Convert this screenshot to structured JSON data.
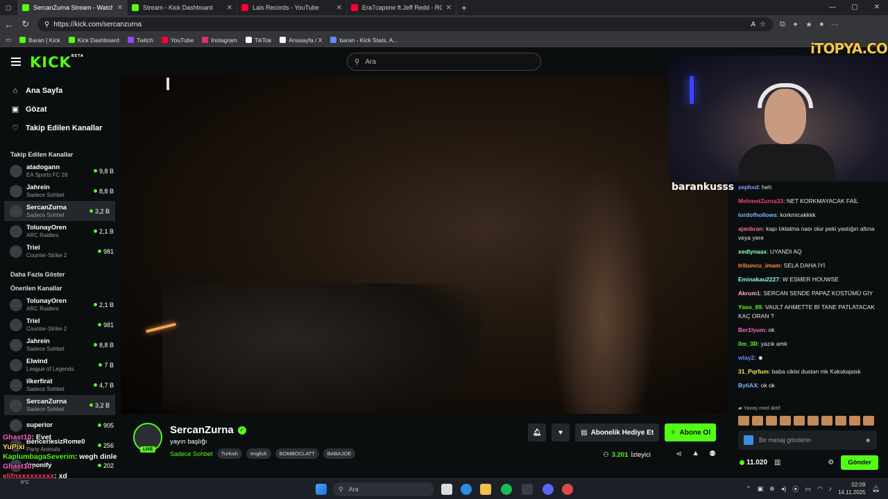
{
  "browser": {
    "tabs": [
      {
        "title": "SercanZurna Stream - Watch",
        "color": "#53fc18",
        "active": true
      },
      {
        "title": "Stream - Kick Dashboard",
        "color": "#53fc18",
        "active": false
      },
      {
        "title": "Lais Records - YouTube",
        "color": "#ff0033",
        "active": false
      },
      {
        "title": "Era7capone ft.Jeff Redd - ROMAN",
        "color": "#ff0033",
        "active": false
      }
    ],
    "url": "https://kick.com/sercanzurna",
    "bookmarks": [
      "Baran | Kick",
      "Kick Dashboard",
      "Twitch",
      "YouTube",
      "Instagram",
      "TikTok",
      "Anasayfa / X",
      "baran - Kick Stats, A..."
    ]
  },
  "kick": {
    "logo": "KICK",
    "logo_badge": "BETA",
    "search_placeholder": "Ara",
    "nav": {
      "home": "Ana Sayfa",
      "browse": "Gözat",
      "following": "Takip Edilen Kanallar"
    },
    "followed_title": "Takip Edilen Kanallar",
    "followed": [
      {
        "name": "atadogann",
        "cat": "EA Sports FC 26",
        "viewers": "9,8 B"
      },
      {
        "name": "Jahrein",
        "cat": "Sadece Sohbet",
        "viewers": "8,8 B"
      },
      {
        "name": "SercanZurna",
        "cat": "Sadece Sohbet",
        "viewers": "3,2 B"
      },
      {
        "name": "TolunayOren",
        "cat": "ARC Raiders",
        "viewers": "2,1 B"
      },
      {
        "name": "Triel",
        "cat": "Counter-Strike 2",
        "viewers": "981"
      }
    ],
    "show_more": "Daha Fazla Göster",
    "recommended_title": "Önerilen Kanallar",
    "recommended": [
      {
        "name": "TolunayOren",
        "cat": "ARC Raiders",
        "viewers": "2,1 B"
      },
      {
        "name": "Triel",
        "cat": "Counter-Strike 2",
        "viewers": "981"
      },
      {
        "name": "Jahrein",
        "cat": "Sadece Sohbet",
        "viewers": "8,8 B"
      },
      {
        "name": "Elwind",
        "cat": "League of Legends",
        "viewers": "7 B"
      },
      {
        "name": "ilkerfirat",
        "cat": "Sadece Sohbet",
        "viewers": "4,7 B"
      },
      {
        "name": "SercanZurna",
        "cat": "Sadece Sohbet",
        "viewers": "3,2 B"
      },
      {
        "name": "superior",
        "cat": "",
        "viewers": "905"
      },
      {
        "name": "BenceriksizRome0",
        "cat": "Party Animals",
        "viewers": "256"
      },
      {
        "name": "limonify",
        "cat": "",
        "viewers": "202"
      }
    ],
    "stream": {
      "title": "SercanZurna",
      "subtitle": "yayın başlığı",
      "category": "Sadece Sohbet",
      "tags": [
        "Turkish",
        "english",
        "BOMBOCLATT",
        "BABAJOE"
      ],
      "live": "LIVE",
      "gift_sub": "Abonelik Hediye Et",
      "subscribe": "Abone Ol",
      "viewers": "3.201",
      "viewers_label": "İzleyici"
    },
    "watermark": "iTOPYA.COM",
    "cam_name": "barankusss",
    "chat": [
      {
        "user": "zephxd",
        "color": "#7fa3ff",
        "text": "heh"
      },
      {
        "user": "MehmetZurna33",
        "color": "#ff3c6a",
        "text": "NET KORKMAYACAK FAİL"
      },
      {
        "user": "lordofhollows",
        "color": "#7fb8ff",
        "text": "korkmicakkkk"
      },
      {
        "user": "ajanbran",
        "color": "#ff6a8a",
        "text": "kapı tıklatma nası olur peki yastığın altına veya yere"
      },
      {
        "user": "xedlynaax",
        "color": "#8affb8",
        "text": "UYANDI AQ"
      },
      {
        "user": "tribuncu_imam",
        "color": "#ff8c3a",
        "text": "SELA DAHA İYİ"
      },
      {
        "user": "Eminakau2227",
        "color": "#8affe0",
        "text": "W ESMER HOUWSE"
      },
      {
        "user": "Akrum1",
        "color": "#ffb0d0",
        "text": "SERCAN SENDE PAPAZ KOSTÜMÜ GİY"
      },
      {
        "user": "Yaso_69",
        "color": "#53fc18",
        "text": "VAULT AHMETTE Bİ TANE PATLATACAK KAÇ ORAN ?"
      },
      {
        "user": "Ber1lyum",
        "color": "#ff66cc",
        "text": "ok"
      },
      {
        "user": "0m_3R",
        "color": "#53fc18",
        "text": "yazık amk"
      },
      {
        "user": "wlay2",
        "color": "#6a8aff",
        "text": "☻"
      },
      {
        "user": "31_Pqrfum",
        "color": "#ffe066",
        "text": "baba cikisi dustan mk Kakskajsisk"
      },
      {
        "user": "BytiAX",
        "color": "#7fb8ff",
        "text": "ok ok"
      }
    ],
    "slow_mode": "Yavaş mod aktif",
    "chat_placeholder": "Bir mesaj gönderin",
    "points": "11.020",
    "send": "Gönder"
  },
  "overlay_chat": [
    {
      "user": "Ghast10",
      "color": "#ff66cc",
      "text": ": Evet"
    },
    {
      "user": "YuPixi",
      "color": "#ffe066",
      "text": ""
    },
    {
      "user": "KaplumbagaSeverim",
      "color": "#53fc18",
      "text": ": wegh dinle"
    },
    {
      "user": "Ghast10",
      "color": "#ff66cc",
      "text": ":"
    },
    {
      "user": "elifnxxxxxxxxx",
      "color": "#ff3c6a",
      "text": ": xd"
    }
  ],
  "taskbar": {
    "search": "Ara",
    "weather": "9°C",
    "time": "02:09",
    "date": "14.11.2025"
  }
}
